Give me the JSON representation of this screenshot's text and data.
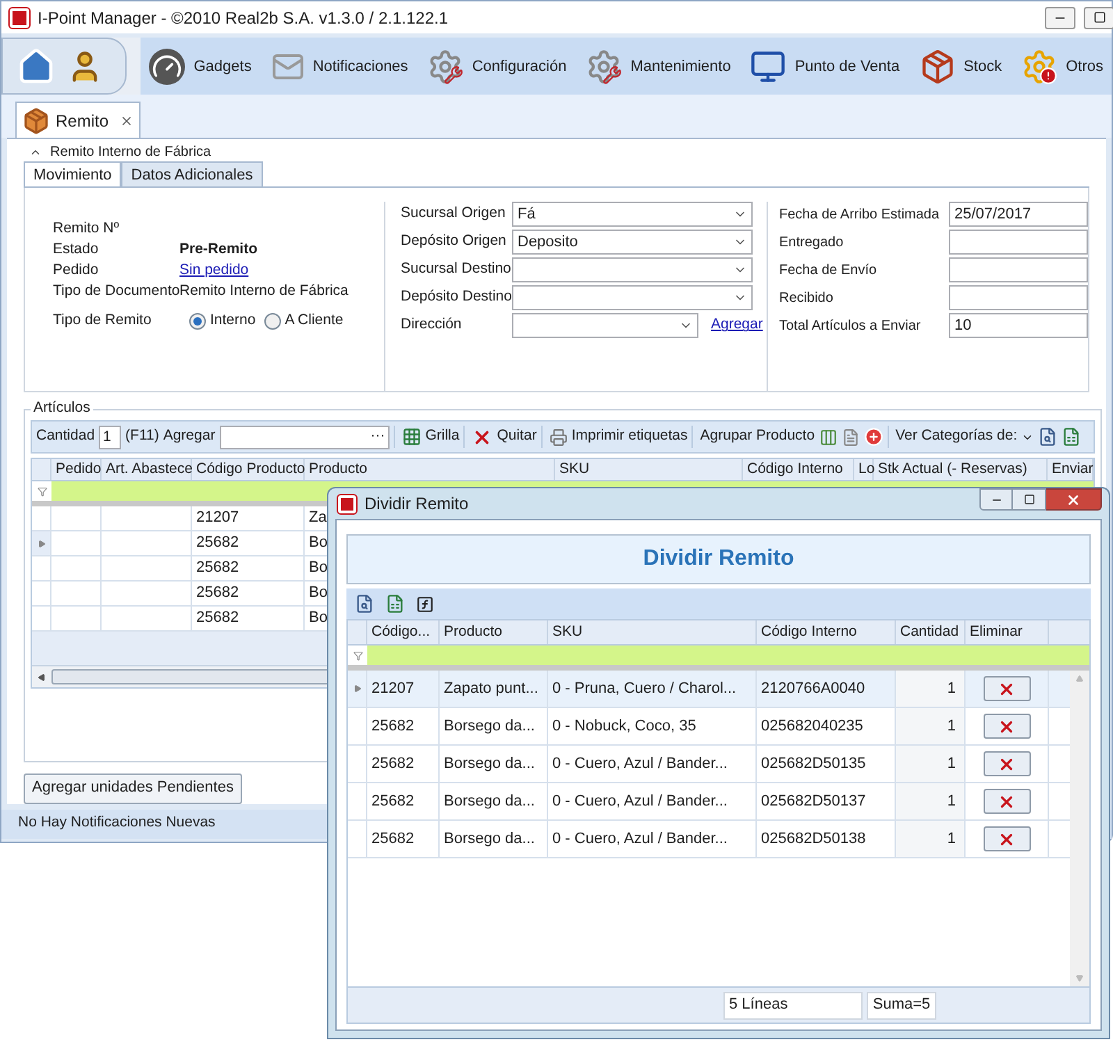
{
  "window": {
    "title": "I-Point Manager - ©2010 Real2b S.A. v1.3.0 / 2.1.122.1"
  },
  "ribbon": {
    "items": [
      {
        "label": "Gadgets",
        "kind": "gauge"
      },
      {
        "label": "Notificaciones",
        "kind": "envelope"
      },
      {
        "label": "Configuración",
        "kind": "gear-wrench"
      },
      {
        "label": "Mantenimiento",
        "kind": "gear-wrench"
      },
      {
        "label": "Punto de Venta",
        "kind": "monitor"
      },
      {
        "label": "Stock",
        "kind": "boxes"
      },
      {
        "label": "Otros",
        "kind": "gear-alert"
      }
    ]
  },
  "document_tabs": [
    {
      "label": "Remito",
      "selected": true
    }
  ],
  "form": {
    "section_title": "Remito Interno de Fábrica",
    "tabs": [
      {
        "label": "Movimiento",
        "selected": true
      },
      {
        "label": "Datos Adicionales",
        "selected": false
      }
    ],
    "left_fields": [
      {
        "label": "Remito Nº"
      },
      {
        "label": "Estado",
        "value": "Pre-Remito",
        "kind": "bold"
      },
      {
        "label": "Pedido",
        "value": "Sin pedido",
        "kind": "link"
      },
      {
        "label": "Tipo de Documento",
        "value": "Remito Interno de Fábrica",
        "kind": "text"
      }
    ],
    "tipo_remito": {
      "label": "Tipo de Remito",
      "options": [
        {
          "label": "Interno",
          "selected": true
        },
        {
          "label": "A Cliente",
          "selected": false
        }
      ]
    },
    "middle_fields": [
      {
        "label": "Sucursal Origen",
        "value": "Fá"
      },
      {
        "label": "Depósito Origen",
        "value": "Deposito"
      },
      {
        "label": "Sucursal Destino"
      },
      {
        "label": "Depósito Destino"
      },
      {
        "label": "Dirección",
        "link": "Agregar"
      }
    ],
    "right_fields": [
      {
        "label": "Fecha de Arribo Estimada",
        "value": "25/07/2017"
      },
      {
        "label": "Entregado"
      },
      {
        "label": "Fecha de Envío"
      },
      {
        "label": "Recibido"
      },
      {
        "label": "Total Artículos a Enviar",
        "value": "10"
      }
    ]
  },
  "articles": {
    "title": "Artículos",
    "toolbar": {
      "quantity_label": "Cantidad",
      "quantity": "1",
      "shortcut": "(F11)",
      "add_label": "Agregar",
      "add_ellipsis": "···",
      "buttons": [
        {
          "label": "Grilla",
          "kind": "grid"
        },
        {
          "label": "Quitar",
          "kind": "remove"
        },
        {
          "label": "Imprimir etiquetas",
          "kind": "print"
        },
        {
          "label": "Agrupar Producto",
          "kind": "plain"
        }
      ],
      "categories": "Ver Categorías de:"
    },
    "columns": [
      "Pedido",
      "Art. Abastece",
      "Código Producto",
      "Producto",
      "SKU",
      "Código Interno",
      "Lo",
      "Stk Actual (- Reservas)",
      "Enviar"
    ],
    "rows": [
      {
        "codigo": "21207",
        "producto": "Za",
        "selected": false
      },
      {
        "codigo": "25682",
        "producto": "Bo",
        "selected": true
      },
      {
        "codigo": "25682",
        "producto": "Bo",
        "selected": false
      },
      {
        "codigo": "25682",
        "producto": "Bo",
        "selected": false
      },
      {
        "codigo": "25682",
        "producto": "Bo",
        "selected": false
      }
    ],
    "footer_button": "Agregar unidades Pendientes"
  },
  "status_bar": "No Hay Notificaciones Nuevas",
  "dialog": {
    "title": "Dividir Remito",
    "heading": "Dividir Remito",
    "columns": [
      "Código...",
      "Producto",
      "SKU",
      "Código Interno",
      "Cantidad",
      "Eliminar"
    ],
    "rows": [
      {
        "codigo": "21207",
        "producto": "Zapato punt...",
        "sku": "0 - Pruna, Cuero / Charol...",
        "codigo_interno": "2120766A0040",
        "cantidad": "1",
        "selected": true
      },
      {
        "codigo": "25682",
        "producto": "Borsego da...",
        "sku": "0 - Nobuck, Coco, 35",
        "codigo_interno": "025682040235",
        "cantidad": "1",
        "selected": false
      },
      {
        "codigo": "25682",
        "producto": "Borsego da...",
        "sku": "0 - Cuero, Azul / Bander...",
        "codigo_interno": "025682D50135",
        "cantidad": "1",
        "selected": false
      },
      {
        "codigo": "25682",
        "producto": "Borsego da...",
        "sku": "0 - Cuero, Azul / Bander...",
        "codigo_interno": "025682D50137",
        "cantidad": "1",
        "selected": false
      },
      {
        "codigo": "25682",
        "producto": "Borsego da...",
        "sku": "0 - Cuero, Azul / Bander...",
        "codigo_interno": "025682D50138",
        "cantidad": "1",
        "selected": false
      }
    ],
    "footer": {
      "lines": "5 Líneas",
      "sum": "Suma=5"
    }
  }
}
